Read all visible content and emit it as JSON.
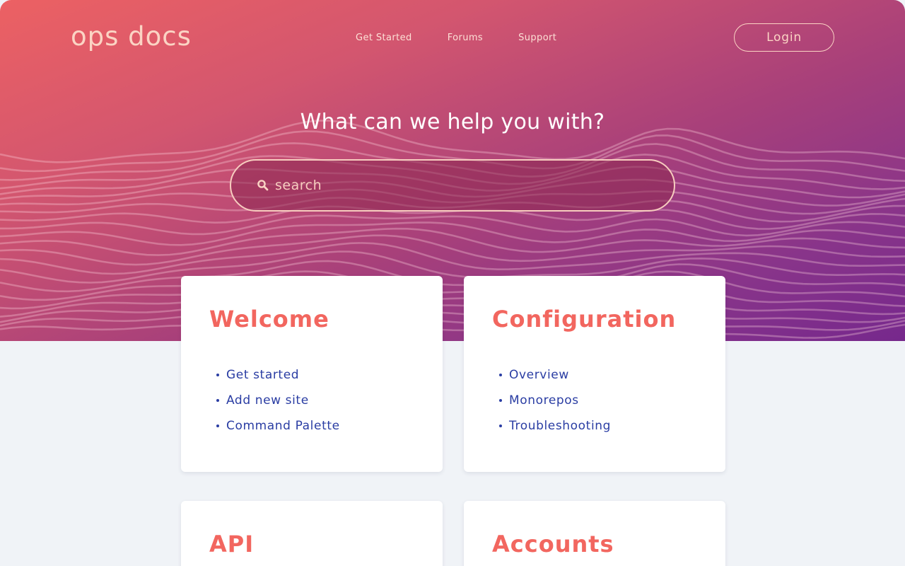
{
  "colors": {
    "gradient_start": "#ec6163",
    "gradient_end": "#76288c",
    "accent": "#f2665f",
    "link": "#2a3da3",
    "logo": "#fbd4c4",
    "page_background": "#f0f3f7"
  },
  "header": {
    "logo": "ops docs",
    "nav": [
      {
        "label": "Get Started"
      },
      {
        "label": "Forums"
      },
      {
        "label": "Support"
      }
    ],
    "login_label": "Login"
  },
  "hero": {
    "title": "What can we help you with?",
    "search": {
      "icon": "search-icon",
      "placeholder": "search",
      "value": ""
    }
  },
  "cards": [
    {
      "title": "Welcome",
      "links": [
        {
          "label": "Get started"
        },
        {
          "label": "Add new site"
        },
        {
          "label": "Command Palette"
        }
      ]
    },
    {
      "title": "Configuration",
      "links": [
        {
          "label": "Overview"
        },
        {
          "label": "Monorepos"
        },
        {
          "label": "Troubleshooting"
        }
      ]
    },
    {
      "title": "API",
      "links": []
    },
    {
      "title": "Accounts",
      "links": []
    }
  ]
}
